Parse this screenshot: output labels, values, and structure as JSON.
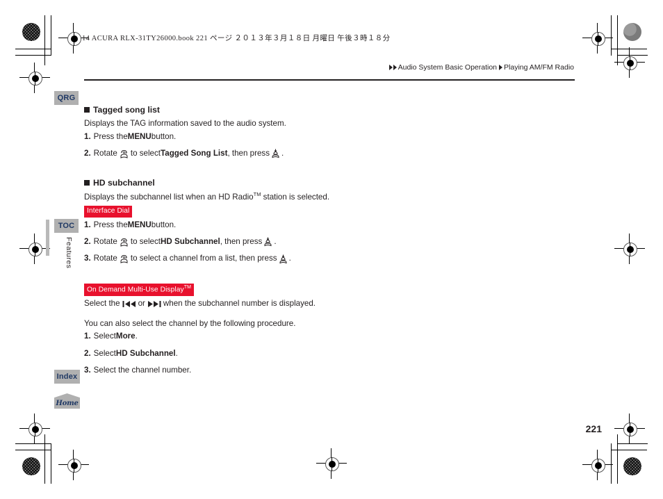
{
  "print_header": "14 ACURA RLX-31TY26000.book   221 ページ   ２０１３年３月１８日   月曜日   午後３時１８分",
  "breadcrumb": {
    "level1": "Audio System Basic Operation",
    "level2": "Playing AM/FM Radio"
  },
  "sidebar": {
    "qrg_label": "QRG",
    "toc_label": "TOC",
    "index_label": "Index",
    "home_label": "Home",
    "section_label": "Features"
  },
  "sections": [
    {
      "heading": "Tagged song list",
      "description": "Displays the TAG information saved to the audio system.",
      "steps": [
        {
          "num": "1.",
          "pre": "Press the ",
          "bold": "MENU",
          "post": " button."
        },
        {
          "num": "2.",
          "pre": "Rotate ",
          "mid": " to select ",
          "bold": "Tagged Song List",
          "post": ", then press "
        }
      ]
    },
    {
      "heading": "HD subchannel",
      "description_pre": "Displays the subchannel list when an HD Radio",
      "description_tm": "TM",
      "description_post": " station is selected.",
      "badge": "Interface Dial",
      "steps": [
        {
          "num": "1.",
          "pre": "Press the ",
          "bold": "MENU",
          "post": " button."
        },
        {
          "num": "2.",
          "pre": "Rotate ",
          "mid": " to select ",
          "bold": "HD Subchannel",
          "post": ", then press "
        },
        {
          "num": "3.",
          "pre": "Rotate ",
          "mid": " to select a channel from a list, then press "
        }
      ],
      "badge2": "On Demand Multi-Use Display",
      "badge2_tm": "TM",
      "odmd_pre": "Select the ",
      "odmd_mid": " or ",
      "odmd_post": " when the subchannel number is displayed.",
      "alt_intro": "You can also select the channel by the following procedure.",
      "alt_steps": [
        {
          "num": "1.",
          "pre": "Select ",
          "bold": "More",
          "post": "."
        },
        {
          "num": "2.",
          "pre": "Select ",
          "bold": "HD Subchannel",
          "post": "."
        },
        {
          "num": "3.",
          "pre": "Select the channel number.",
          "bold": "",
          "post": ""
        }
      ]
    }
  ],
  "page_number": "221",
  "colors": {
    "badge_red": "#e8112d",
    "tab_gray": "#b0b0b0",
    "tab_text": "#1f3864",
    "body_text": "#231f20"
  }
}
